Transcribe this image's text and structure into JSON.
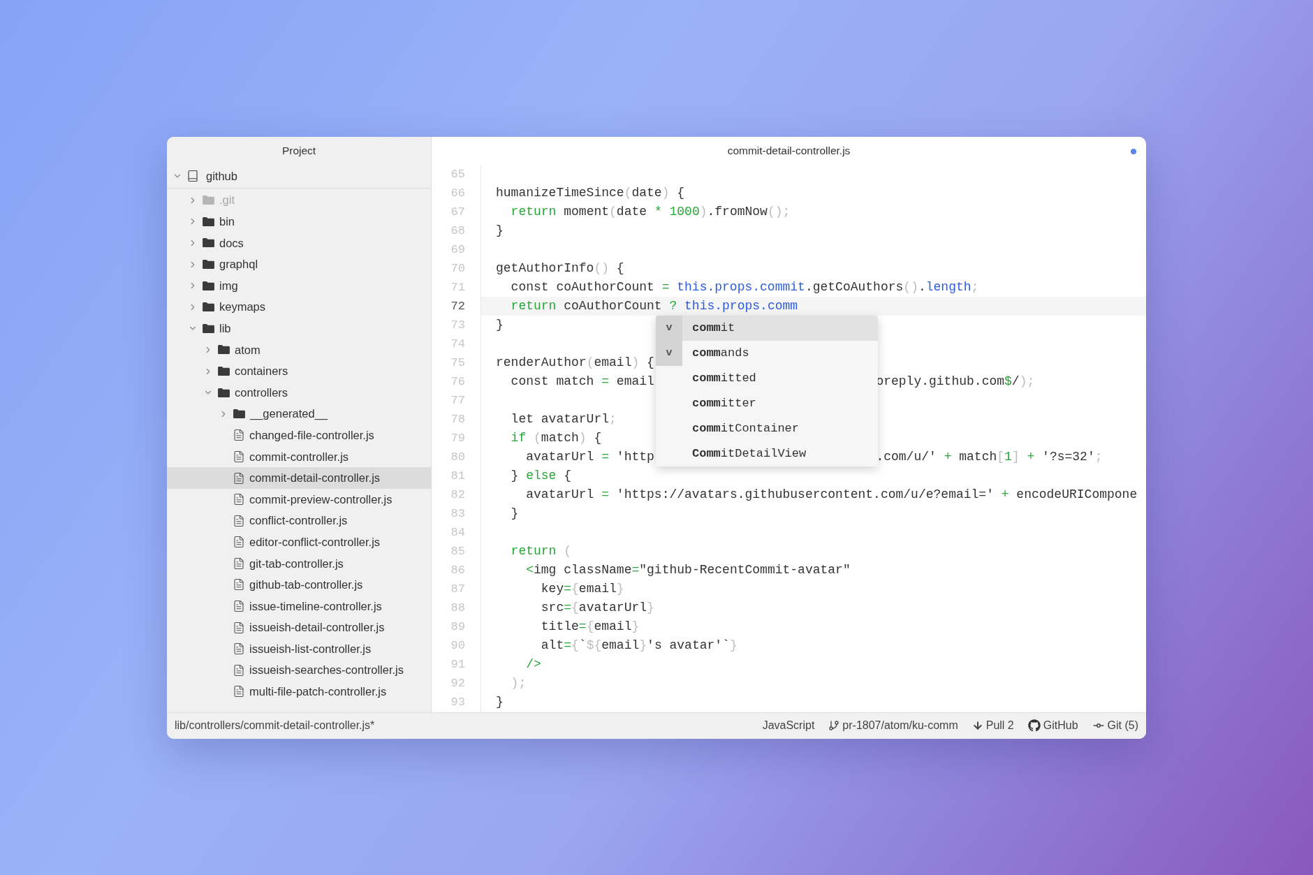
{
  "sidebar": {
    "title": "Project",
    "root": {
      "name": "github",
      "kind": "repo",
      "expanded": true
    },
    "items": [
      {
        "name": ".git",
        "kind": "folder",
        "expanded": false,
        "selected": false,
        "ignored": true
      },
      {
        "name": "bin",
        "kind": "folder",
        "expanded": false,
        "selected": false,
        "ignored": false
      },
      {
        "name": "docs",
        "kind": "folder",
        "expanded": false,
        "selected": false,
        "ignored": false
      },
      {
        "name": "graphql",
        "kind": "folder",
        "expanded": false,
        "selected": false,
        "ignored": false
      },
      {
        "name": "img",
        "kind": "folder",
        "expanded": false,
        "selected": false,
        "ignored": false
      },
      {
        "name": "keymaps",
        "kind": "folder",
        "expanded": false,
        "selected": false,
        "ignored": false
      },
      {
        "name": "lib",
        "kind": "folder",
        "expanded": true,
        "selected": false,
        "ignored": false,
        "children": [
          {
            "name": "atom",
            "kind": "folder",
            "expanded": false,
            "selected": false,
            "ignored": false
          },
          {
            "name": "containers",
            "kind": "folder",
            "expanded": false,
            "selected": false,
            "ignored": false
          },
          {
            "name": "controllers",
            "kind": "folder",
            "expanded": true,
            "selected": false,
            "ignored": false,
            "children": [
              {
                "name": "__generated__",
                "kind": "folder",
                "expanded": false,
                "selected": false,
                "ignored": false
              },
              {
                "name": "changed-file-controller.js",
                "kind": "file",
                "selected": false,
                "ignored": false
              },
              {
                "name": "commit-controller.js",
                "kind": "file",
                "selected": false,
                "ignored": false
              },
              {
                "name": "commit-detail-controller.js",
                "kind": "file",
                "selected": true,
                "ignored": false
              },
              {
                "name": "commit-preview-controller.js",
                "kind": "file",
                "selected": false,
                "ignored": false
              },
              {
                "name": "conflict-controller.js",
                "kind": "file",
                "selected": false,
                "ignored": false
              },
              {
                "name": "editor-conflict-controller.js",
                "kind": "file",
                "selected": false,
                "ignored": false
              },
              {
                "name": "git-tab-controller.js",
                "kind": "file",
                "selected": false,
                "ignored": false
              },
              {
                "name": "github-tab-controller.js",
                "kind": "file",
                "selected": false,
                "ignored": false
              },
              {
                "name": "issue-timeline-controller.js",
                "kind": "file",
                "selected": false,
                "ignored": false
              },
              {
                "name": "issueish-detail-controller.js",
                "kind": "file",
                "selected": false,
                "ignored": false
              },
              {
                "name": "issueish-list-controller.js",
                "kind": "file",
                "selected": false,
                "ignored": false
              },
              {
                "name": "issueish-searches-controller.js",
                "kind": "file",
                "selected": false,
                "ignored": false
              },
              {
                "name": "multi-file-patch-controller.js",
                "kind": "file",
                "selected": false,
                "ignored": false
              }
            ]
          }
        ]
      }
    ]
  },
  "editor": {
    "tab": {
      "title": "commit-detail-controller.js",
      "modified": true
    },
    "lines": [
      {
        "number": "65",
        "current": false
      },
      {
        "number": "66",
        "current": false,
        "tokens": [
          {
            "text": "humanizeTimeSince",
            "kind": "plain"
          },
          {
            "text": "(",
            "kind": "punct"
          },
          {
            "text": "date",
            "kind": "plain"
          },
          {
            "text": ")",
            "kind": "punct"
          },
          {
            "text": " {",
            "kind": "plain"
          }
        ]
      },
      {
        "number": "67",
        "current": false,
        "tokens": [
          {
            "text": "  return",
            "kind": "keyword"
          },
          {
            "text": " moment",
            "kind": "plain"
          },
          {
            "text": "(",
            "kind": "punct"
          },
          {
            "text": "date ",
            "kind": "plain"
          },
          {
            "text": "* 1000",
            "kind": "keyword"
          },
          {
            "text": ")",
            "kind": "punct"
          },
          {
            "text": ".fromNow",
            "kind": "plain"
          },
          {
            "text": "();",
            "kind": "punct"
          }
        ]
      },
      {
        "number": "68",
        "current": false,
        "tokens": [
          {
            "text": "}",
            "kind": "plain"
          }
        ]
      },
      {
        "number": "69",
        "current": false
      },
      {
        "number": "70",
        "current": false,
        "tokens": [
          {
            "text": "getAuthorInfo",
            "kind": "plain"
          },
          {
            "text": "()",
            "kind": "punct"
          },
          {
            "text": " {",
            "kind": "plain"
          }
        ]
      },
      {
        "number": "71",
        "current": false,
        "tokens": [
          {
            "text": "  const coAuthorCount ",
            "kind": "plain"
          },
          {
            "text": "= ",
            "kind": "keyword"
          },
          {
            "text": "this.props.commit",
            "kind": "property"
          },
          {
            "text": ".getCoAuthors",
            "kind": "plain"
          },
          {
            "text": "()",
            "kind": "punct"
          },
          {
            "text": ".",
            "kind": "plain"
          },
          {
            "text": "length",
            "kind": "property"
          },
          {
            "text": ";",
            "kind": "punct"
          }
        ]
      },
      {
        "number": "72",
        "current": true,
        "tokens": [
          {
            "text": "  return",
            "kind": "keyword"
          },
          {
            "text": " coAuthorCount ",
            "kind": "plain"
          },
          {
            "text": "? ",
            "kind": "keyword"
          },
          {
            "text": "this.props.comm",
            "kind": "property"
          }
        ]
      },
      {
        "number": "73",
        "current": false,
        "tokens": [
          {
            "text": "}",
            "kind": "plain"
          }
        ]
      },
      {
        "number": "74",
        "current": false
      },
      {
        "number": "75",
        "current": false,
        "tokens": [
          {
            "text": "renderAuthor",
            "kind": "plain"
          },
          {
            "text": "(",
            "kind": "punct"
          },
          {
            "text": "email",
            "kind": "plain"
          },
          {
            "text": ")",
            "kind": "punct"
          },
          {
            "text": " {",
            "kind": "plain"
          }
        ]
      },
      {
        "number": "76",
        "current": false,
        "tokens": [
          {
            "text": "  const match ",
            "kind": "plain"
          },
          {
            "text": "=",
            "kind": "keyword"
          },
          {
            "text": " email",
            "kind": "plain"
          }
        ],
        "after_popup": [
          {
            "text": "oreply.github.com",
            "kind": "plain"
          },
          {
            "text": "$",
            "kind": "keyword"
          },
          {
            "text": "/",
            "kind": "plain"
          },
          {
            "text": ");",
            "kind": "punct"
          }
        ]
      },
      {
        "number": "77",
        "current": false
      },
      {
        "number": "78",
        "current": false,
        "tokens": [
          {
            "text": "  let avatarUrl",
            "kind": "plain"
          },
          {
            "text": ";",
            "kind": "punct"
          }
        ]
      },
      {
        "number": "79",
        "current": false,
        "tokens": [
          {
            "text": "  if ",
            "kind": "keyword"
          },
          {
            "text": "(",
            "kind": "punct"
          },
          {
            "text": "match",
            "kind": "plain"
          },
          {
            "text": ")",
            "kind": "punct"
          },
          {
            "text": " {",
            "kind": "plain"
          }
        ]
      },
      {
        "number": "80",
        "current": false,
        "tokens": [
          {
            "text": "    avatarUrl ",
            "kind": "plain"
          },
          {
            "text": "=",
            "kind": "keyword"
          },
          {
            "text": " 'http",
            "kind": "plain"
          }
        ],
        "after_popup": [
          {
            "text": ".com/u/' ",
            "kind": "plain"
          },
          {
            "text": "+",
            "kind": "keyword"
          },
          {
            "text": " match",
            "kind": "plain"
          },
          {
            "text": "[",
            "kind": "punct"
          },
          {
            "text": "1",
            "kind": "keyword"
          },
          {
            "text": "] ",
            "kind": "punct"
          },
          {
            "text": "+",
            "kind": "keyword"
          },
          {
            "text": " '?s=32'",
            "kind": "plain"
          },
          {
            "text": ";",
            "kind": "punct"
          }
        ]
      },
      {
        "number": "81",
        "current": false,
        "tokens": [
          {
            "text": "  } ",
            "kind": "plain"
          },
          {
            "text": "else",
            "kind": "keyword"
          },
          {
            "text": " {",
            "kind": "plain"
          }
        ]
      },
      {
        "number": "82",
        "current": false,
        "tokens": [
          {
            "text": "    avatarUrl ",
            "kind": "plain"
          },
          {
            "text": "=",
            "kind": "keyword"
          },
          {
            "text": " 'https://avatars.githubusercontent.com/u/e?email=' ",
            "kind": "plain"
          },
          {
            "text": "+",
            "kind": "keyword"
          },
          {
            "text": " encodeURICompone",
            "kind": "plain"
          }
        ]
      },
      {
        "number": "83",
        "current": false,
        "tokens": [
          {
            "text": "  }",
            "kind": "plain"
          }
        ]
      },
      {
        "number": "84",
        "current": false
      },
      {
        "number": "85",
        "current": false,
        "tokens": [
          {
            "text": "  return ",
            "kind": "keyword"
          },
          {
            "text": "(",
            "kind": "punct"
          }
        ]
      },
      {
        "number": "86",
        "current": false,
        "tokens": [
          {
            "text": "    <",
            "kind": "keyword"
          },
          {
            "text": "img className",
            "kind": "plain"
          },
          {
            "text": "=",
            "kind": "keyword"
          },
          {
            "text": "\"github-RecentCommit-avatar\"",
            "kind": "plain"
          }
        ]
      },
      {
        "number": "87",
        "current": false,
        "tokens": [
          {
            "text": "      key",
            "kind": "plain"
          },
          {
            "text": "=",
            "kind": "keyword"
          },
          {
            "text": "{",
            "kind": "punct"
          },
          {
            "text": "email",
            "kind": "plain"
          },
          {
            "text": "}",
            "kind": "punct"
          }
        ]
      },
      {
        "number": "88",
        "current": false,
        "tokens": [
          {
            "text": "      src",
            "kind": "plain"
          },
          {
            "text": "=",
            "kind": "keyword"
          },
          {
            "text": "{",
            "kind": "punct"
          },
          {
            "text": "avatarUrl",
            "kind": "plain"
          },
          {
            "text": "}",
            "kind": "punct"
          }
        ]
      },
      {
        "number": "89",
        "current": false,
        "tokens": [
          {
            "text": "      title",
            "kind": "plain"
          },
          {
            "text": "=",
            "kind": "keyword"
          },
          {
            "text": "{",
            "kind": "punct"
          },
          {
            "text": "email",
            "kind": "plain"
          },
          {
            "text": "}",
            "kind": "punct"
          }
        ]
      },
      {
        "number": "90",
        "current": false,
        "tokens": [
          {
            "text": "      alt",
            "kind": "plain"
          },
          {
            "text": "=",
            "kind": "keyword"
          },
          {
            "text": "{",
            "kind": "punct"
          },
          {
            "text": "`",
            "kind": "plain"
          },
          {
            "text": "${",
            "kind": "punct"
          },
          {
            "text": "email",
            "kind": "plain"
          },
          {
            "text": "}",
            "kind": "punct"
          },
          {
            "text": "'s avatar'`",
            "kind": "plain"
          },
          {
            "text": "}",
            "kind": "punct"
          }
        ]
      },
      {
        "number": "91",
        "current": false,
        "tokens": [
          {
            "text": "    />",
            "kind": "keyword"
          }
        ]
      },
      {
        "number": "92",
        "current": false,
        "tokens": [
          {
            "text": "  );",
            "kind": "punct"
          }
        ]
      },
      {
        "number": "93",
        "current": false,
        "tokens": [
          {
            "text": "}",
            "kind": "plain"
          }
        ]
      }
    ],
    "autocomplete": [
      {
        "badge": "v",
        "label": "**comm**it",
        "selected": true
      },
      {
        "badge": "v",
        "label": "**comm**ands",
        "selected": false
      },
      {
        "label": "**comm**itted",
        "selected": false
      },
      {
        "label": "**comm**itter",
        "selected": false
      },
      {
        "label": "**comm**itContainer",
        "selected": false
      },
      {
        "label": "**Comm**itDetailView",
        "selected": false
      }
    ]
  },
  "status_bar": {
    "path": "lib/controllers/commit-detail-controller.js*",
    "items": [
      {
        "kind": "grammar",
        "text": "JavaScript"
      },
      {
        "kind": "branch",
        "text": "pr-1807/atom/ku-comm"
      },
      {
        "kind": "pull",
        "text": "Pull 2"
      },
      {
        "kind": "github",
        "text": "GitHub"
      },
      {
        "kind": "git",
        "text": "Git (5)"
      }
    ]
  }
}
